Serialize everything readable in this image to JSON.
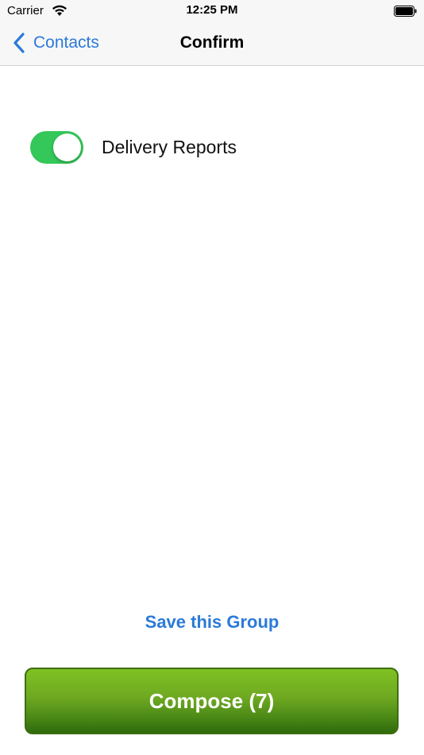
{
  "status_bar": {
    "carrier": "Carrier",
    "time": "12:25 PM"
  },
  "nav": {
    "back_label": "Contacts",
    "title": "Confirm"
  },
  "settings": {
    "delivery_reports_label": "Delivery Reports",
    "delivery_reports_on": true
  },
  "actions": {
    "save_group_label": "Save this Group",
    "compose_label": "Compose (7)"
  },
  "colors": {
    "accent": "#2b7ad9",
    "toggle_on": "#34c759",
    "compose_top": "#7fc223",
    "compose_bottom": "#2f6a0c"
  }
}
